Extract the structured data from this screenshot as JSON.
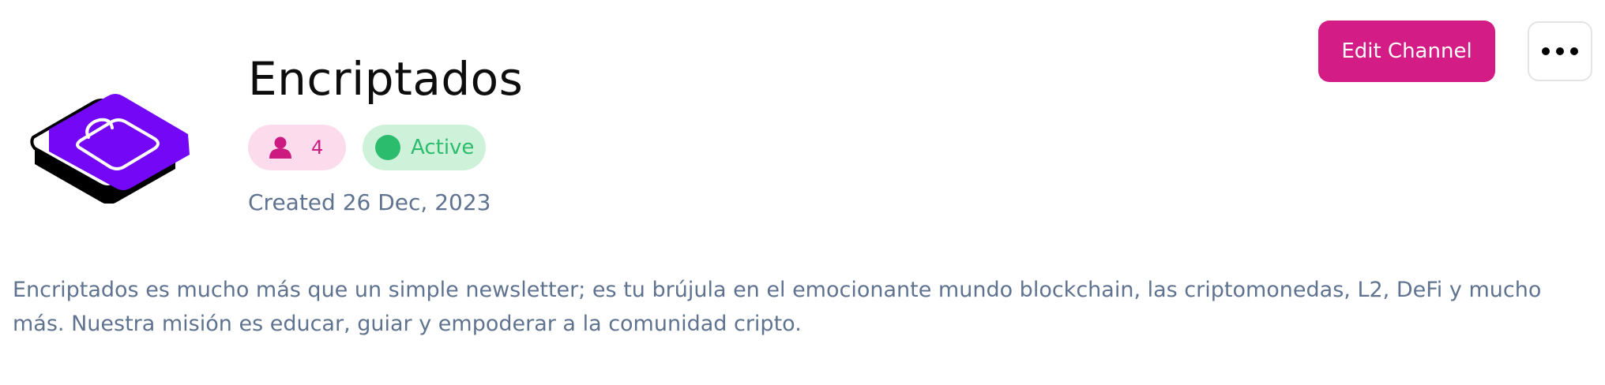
{
  "channel": {
    "name": "Encriptados",
    "member_count": "4",
    "status": "Active",
    "created": "Created 26 Dec, 2023",
    "description": "Encriptados es mucho más que un simple newsletter; es tu brújula en el emocionante mundo blockchain, las criptomonedas, L2, DeFi y mucho más. Nuestra misión es educar, guiar y empoderar a la comunidad cripto."
  },
  "actions": {
    "edit_label": "Edit Channel",
    "more_icon": "more-horizontal-icon"
  },
  "icons": {
    "logo": "padlock-stack-logo",
    "members": "user-icon",
    "status": "status-dot-icon"
  },
  "colors": {
    "accent": "#d31c85",
    "logo_purple": "#7408f6",
    "member_badge_bg": "#fcdcec",
    "member_badge_text": "#cc1a80",
    "status_badge_bg": "#cdf2d9",
    "status_green": "#2cbc6e",
    "muted_text": "#5f7390"
  }
}
